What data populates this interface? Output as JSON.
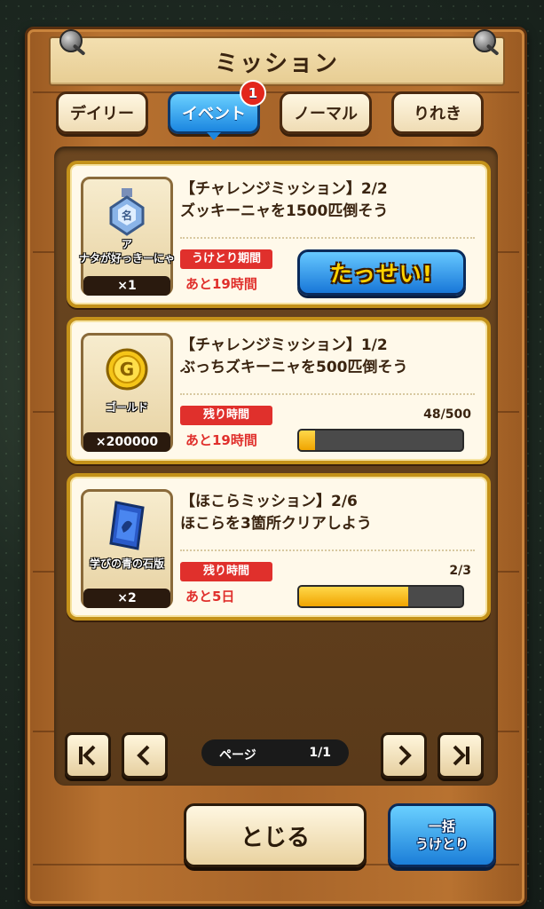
{
  "header": {
    "title": "ミッション"
  },
  "tabs": [
    {
      "label": "デイリー",
      "active": false
    },
    {
      "label": "イベント",
      "active": true,
      "badge": "1"
    },
    {
      "label": "ノーマル",
      "active": false
    },
    {
      "label": "りれき",
      "active": false
    }
  ],
  "missions": [
    {
      "title_line1": "【チャレンジミッション】2/2",
      "title_line2": "ズッキーニャを1500匹倒そう",
      "reward_icon": "medal-icon",
      "reward_name_line1": "ア",
      "reward_name_line2": "ナタが好っきーにゃ",
      "reward_count": "×1",
      "label": "うけとり期間",
      "remaining": "あと19時間",
      "action_label": "たっせい!"
    },
    {
      "title_line1": "【チャレンジミッション】1/2",
      "title_line2": "ぶっちズキーニャを500匹倒そう",
      "reward_icon": "gold-coin-icon",
      "reward_name": "ゴールド",
      "reward_count": "×200000",
      "label": "残り時間",
      "remaining": "あと19時間",
      "progress_text": "48/500",
      "progress": 0.096
    },
    {
      "title_line1": "【ほこらミッション】2/6",
      "title_line2": "ほこらを3箇所クリアしよう",
      "reward_icon": "blue-stone-tablet-icon",
      "reward_name": "学びの青の石版",
      "reward_count": "×2",
      "label": "残り時間",
      "remaining": "あと5日",
      "progress_text": "2/3",
      "progress": 0.667
    }
  ],
  "pager": {
    "label": "ページ",
    "value": "1/1"
  },
  "buttons": {
    "close": "とじる",
    "collect_line1": "一括",
    "collect_line2": "うけとり"
  },
  "colors": {
    "accent_blue": "#1b86e0",
    "label_red": "#e0302c",
    "progress_yellow": "#f0a400",
    "frame_gold": "#c4921a"
  }
}
